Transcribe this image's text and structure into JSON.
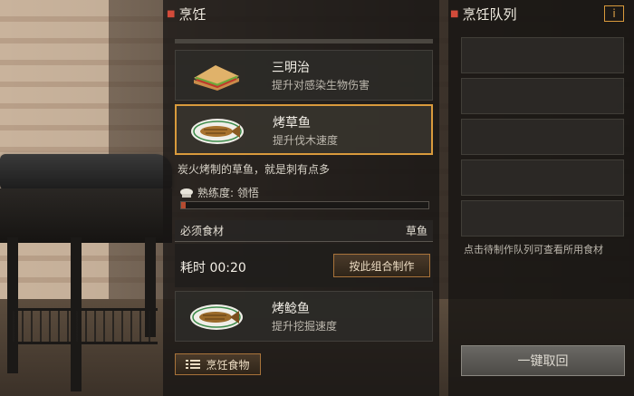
{
  "cooking": {
    "title": "烹饪",
    "recipes": [
      {
        "name": "三明治",
        "desc": "提升对感染生物伤害",
        "icon": "sandwich-icon"
      },
      {
        "name": "烤草鱼",
        "desc": "提升伐木速度",
        "icon": "grilled-fish-icon"
      },
      {
        "name": "烤鲶鱼",
        "desc": "提升挖掘速度",
        "icon": "grilled-catfish-icon"
      }
    ],
    "detail": {
      "description": "炭火烤制的草鱼，就是刺有点多",
      "proficiency": "熟练度: 领悟",
      "proficiency_progress": 0.02,
      "ingredients_label": "必须食材",
      "ingredients_value": "草鱼",
      "time_label": "耗时 00:20",
      "craft_button": "按此组合制作"
    },
    "cook_food_button": "烹饪食物"
  },
  "queue": {
    "title": "烹饪队列",
    "info_button": "i",
    "hint": "点击待制作队列可查看所用食材",
    "retrieve_button": "一键取回"
  },
  "colors": {
    "accent": "#d99a3c",
    "progress": "#b64b30",
    "bullet": "#d34b3a"
  }
}
